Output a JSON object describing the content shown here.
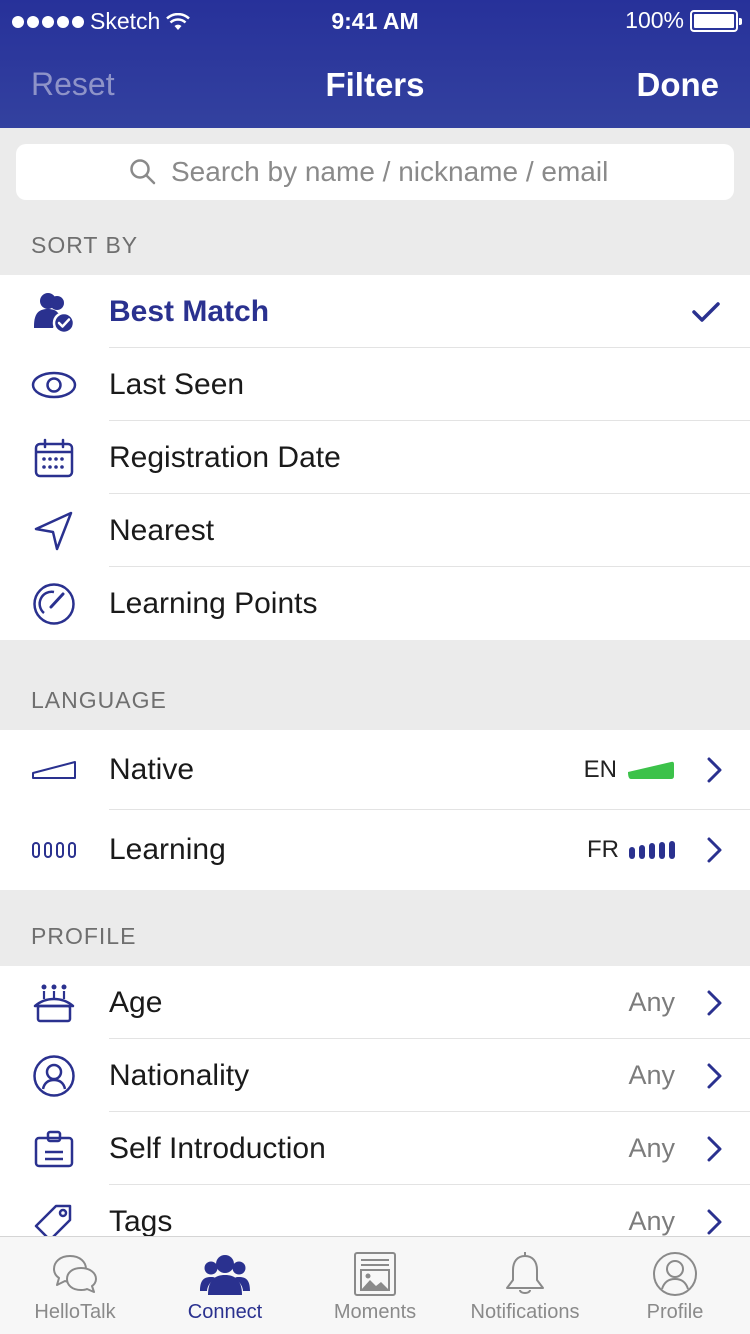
{
  "status": {
    "carrier": "Sketch",
    "time": "9:41 AM",
    "battery": "100%"
  },
  "nav": {
    "reset_label": "Reset",
    "title": "Filters",
    "done_label": "Done"
  },
  "search": {
    "placeholder": "Search by name / nickname / email"
  },
  "sort": {
    "header": "SORT BY",
    "items": [
      {
        "label": "Best Match",
        "icon": "people-check-icon",
        "selected": true
      },
      {
        "label": "Last Seen",
        "icon": "eye-icon"
      },
      {
        "label": "Registration Date",
        "icon": "calendar-icon"
      },
      {
        "label": "Nearest",
        "icon": "navigation-arrow-icon"
      },
      {
        "label": "Learning Points",
        "icon": "gauge-icon"
      }
    ]
  },
  "language": {
    "header": "LANGUAGE",
    "items": [
      {
        "label": "Native",
        "code": "EN",
        "icon": "native-level-icon"
      },
      {
        "label": "Learning",
        "code": "FR",
        "icon": "learning-level-icon"
      }
    ]
  },
  "profile": {
    "header": "PROFILE",
    "items": [
      {
        "label": "Age",
        "value": "Any",
        "icon": "cake-icon"
      },
      {
        "label": "Nationality",
        "value": "Any",
        "icon": "person-circle-icon"
      },
      {
        "label": "Self Introduction",
        "value": "Any",
        "icon": "badge-icon"
      },
      {
        "label": "Tags",
        "value": "Any",
        "icon": "tag-icon"
      }
    ]
  },
  "tabbar": {
    "items": [
      {
        "label": "HelloTalk",
        "icon": "chat-bubbles-icon"
      },
      {
        "label": "Connect",
        "icon": "people-icon",
        "active": true
      },
      {
        "label": "Moments",
        "icon": "moments-icon"
      },
      {
        "label": "Notifications",
        "icon": "bell-icon"
      },
      {
        "label": "Profile",
        "icon": "profile-icon"
      }
    ]
  },
  "colors": {
    "header": "#2e3a9c",
    "accent": "#2a318f",
    "native_bar": "#3cc24a",
    "background": "#ebebeb"
  }
}
